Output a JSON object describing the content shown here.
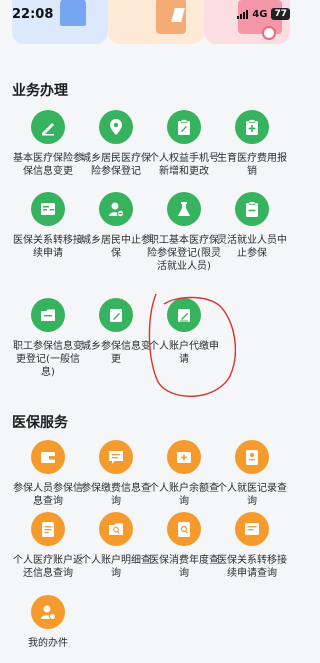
{
  "status_bar": {
    "time": "22:08",
    "network": "4G",
    "battery": "77"
  },
  "colors": {
    "green_icon": "#37b35f",
    "orange_icon": "#f59b2e",
    "annotation": "#d9342b"
  },
  "business": {
    "title": "业务办理",
    "items": [
      {
        "label": "基本医疗保险参保信息变更",
        "icon": "pen-edit-icon"
      },
      {
        "label": "城乡居民医疗保险参保登记",
        "icon": "location-pin-icon"
      },
      {
        "label": "个人权益手机号新增和更改",
        "icon": "clipboard-edit-icon"
      },
      {
        "label": "生育医疗费用报销",
        "icon": "clipboard-plus-icon"
      },
      {
        "label": "医保关系转移接续申请",
        "icon": "card-list-icon"
      },
      {
        "label": "城乡居民中止参保",
        "icon": "user-minus-icon"
      },
      {
        "label": "职工基本医疗保险参保登记(限灵活就业人员)",
        "icon": "flask-icon"
      },
      {
        "label": "灵活就业人员中止参保",
        "icon": "clipboard-minus-icon"
      },
      {
        "label": "职工参保信息变更登记(一般信息)",
        "icon": "folder-edit-icon"
      },
      {
        "label": "城乡参保信息变更",
        "icon": "folder-pen-icon"
      },
      {
        "label": "个人账户代缴申请",
        "icon": "doc-pen-icon"
      }
    ]
  },
  "service": {
    "title": "医保服务",
    "items": [
      {
        "label": "参保人员参保信息查询",
        "icon": "wallet-icon"
      },
      {
        "label": "参保缴费信息查询",
        "icon": "chat-list-icon"
      },
      {
        "label": "个人账户余额查询",
        "icon": "medical-box-icon"
      },
      {
        "label": "个人就医记录查询",
        "icon": "id-card-icon"
      },
      {
        "label": "个人医疗账户返还信息查询",
        "icon": "document-icon"
      },
      {
        "label": "个人账户明细查询",
        "icon": "search-folder-icon"
      },
      {
        "label": "医保消费年度查询",
        "icon": "bill-search-icon"
      },
      {
        "label": "医保关系转移接续申请查询",
        "icon": "transfer-card-icon"
      },
      {
        "label": "我的办件",
        "icon": "user-gear-icon"
      }
    ]
  }
}
